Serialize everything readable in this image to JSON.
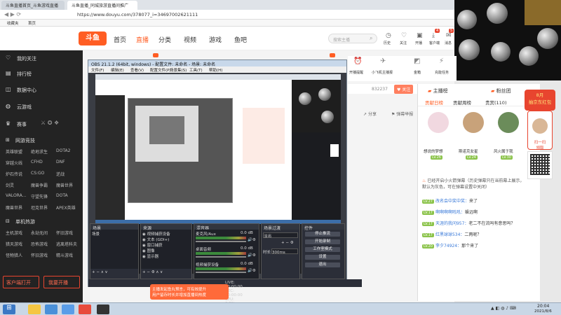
{
  "browser": {
    "tabs": [
      {
        "label": "斗鱼直播首页_斗鱼游戏直播"
      },
      {
        "label": "斗鱼直播_同城旅游直播间推广"
      }
    ],
    "url": "https://www.douyu.com/378077_i=34697002621111",
    "bookmarks": [
      "收藏夹",
      "首页"
    ]
  },
  "header": {
    "logo": "斗鱼",
    "nav": [
      "首页",
      "直播",
      "分类",
      "视频",
      "游戏",
      "鱼吧"
    ],
    "search_placeholder": "搜索主播",
    "icons": [
      "历史",
      "关注",
      "开播",
      "客户端",
      "消息"
    ],
    "badge_client": "4",
    "badge_msg": "5"
  },
  "sidebar": {
    "items": [
      "我的关注",
      "排行榜",
      "数据中心",
      "云游戏",
      "赛事"
    ],
    "section_games": "网游竞技",
    "games": [
      [
        "英雄联盟",
        "绝地求生",
        "DOTA2"
      ],
      [
        "穿越火线",
        "CFHD",
        "DNF"
      ],
      [
        "炉石传说",
        "CS:GO",
        "逆战"
      ],
      [
        "剑灵",
        "魔兽争霸",
        "魔兽世界"
      ],
      [
        "VALORA...",
        "守望先锋",
        "DOTA"
      ],
      [
        "魔兽世界",
        "坦克世界",
        "APEX英雄"
      ]
    ],
    "section_mobile": "单机热游",
    "mobile_games": [
      [
        "主机游戏",
        "永劫无间",
        "怀旧游戏"
      ],
      [
        "猎天游戏",
        "恐怖游戏",
        "逃离塔科夫"
      ],
      [
        "怪物猎人",
        "怀旧游戏",
        "精斗游戏"
      ]
    ],
    "client_btn": "客户端打开",
    "live_btn": "我要开播"
  },
  "obs": {
    "title": "OBS 21.1.2 (64bit, windows) - 配置文件: 未命名 - 场景: 未命名",
    "menu": [
      "文件(F)",
      "编辑(E)",
      "查看(V)",
      "配置文件(P)",
      "场景集(S)",
      "工具(T)",
      "帮助(H)"
    ],
    "docks": {
      "scenes_title": "场景",
      "scenes": [
        "场景"
      ],
      "sources_title": "来源",
      "sources": [
        "视频捕获设备",
        "文本 (GDI+)",
        "窗口捕获",
        "图像",
        "显示器"
      ],
      "mixer_title": "混音器",
      "mixer": [
        {
          "name": "麦克风/Aux",
          "db": "0.0 dB"
        },
        {
          "name": "桌面音频",
          "db": "0.0 dB"
        },
        {
          "name": "视频捕获设备",
          "db": "0.0 dB"
        }
      ],
      "transitions_title": "场景过渡",
      "transition_value": "淡出",
      "duration_label": "时长",
      "duration_value": "300ms",
      "controls_title": "控件",
      "controls": [
        "停止推流",
        "开始录制",
        "工作室模式",
        "设置",
        "退出"
      ]
    },
    "status": "LIVE: 00:00:00   REC: 00:00:00   CPU: 2.8%, 60.00 fps"
  },
  "room": {
    "follow_count": "832237",
    "follow_btn": "关注",
    "share": "分享",
    "report": "弹幕举报",
    "toolbar": [
      "开播提醒",
      "小飞机主播报",
      "金箱",
      "充能任务"
    ]
  },
  "chat": {
    "tabs": [
      "主播榜",
      "粉丝团"
    ],
    "subtabs": [
      "贡献日榜",
      "贡献周榜",
      "贵宾(110)"
    ],
    "fans": [
      {
        "name": "想说的梦想",
        "lv": "LV.26"
      },
      {
        "name": "斯诺克女星",
        "lv": "LV.24"
      },
      {
        "name": "风火属于我",
        "lv": "LV.30"
      }
    ],
    "system_msg": "已经开启小火箭弹幕（历史弹幕只在当前幕上展示，默认为灰色，可在弹幕设置中关闭）",
    "messages": [
      {
        "lv": "LV.27",
        "user": "改名会中奖中奖：",
        "text": "来了"
      },
      {
        "lv": "LV.17",
        "user": "啊啊啊啊吼吼：",
        "text": "躲远啊"
      },
      {
        "lv": "LV.17",
        "user": "天涯的我问957：",
        "text": "老二不在流吗有意思吗？"
      },
      {
        "lv": "LV.17",
        "user": "红黑球球534：",
        "text": "二两呢？"
      },
      {
        "lv": "LV.20",
        "user": "李夕74924：",
        "text": "那个来了"
      }
    ],
    "promo_text": "8月\n抽京东红包",
    "qr_label": "扫一扫\n领取"
  },
  "tooltip": "主播发起鱼丸预言，可有效提升\n用户留存时长并增加直播间热度",
  "taskbar": {
    "time": "20:04",
    "date": "2021/8/6"
  },
  "colors": {
    "accent": "#ff5d23",
    "sidebar_bg": "#232323",
    "obs_bg": "#2b2e38"
  }
}
